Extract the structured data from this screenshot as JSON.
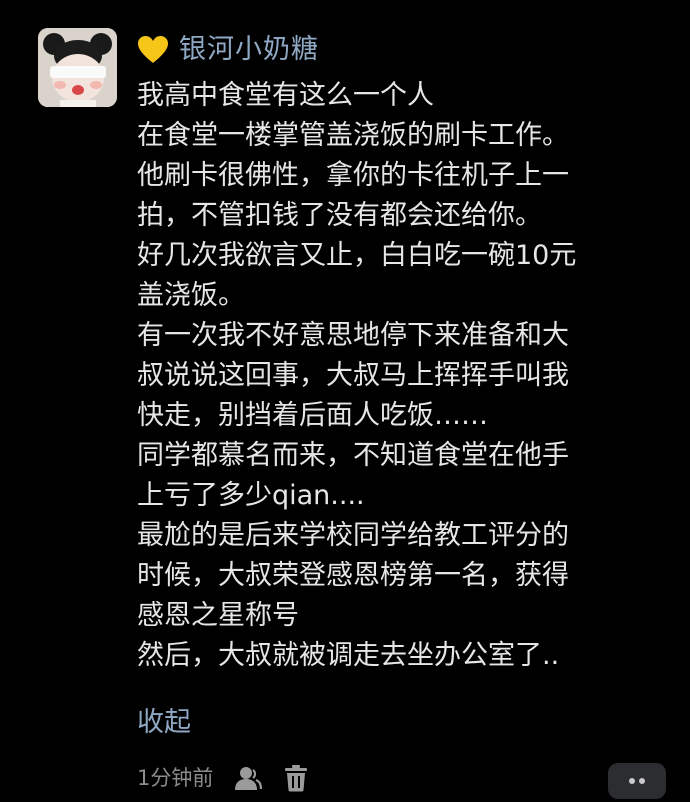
{
  "comment": {
    "username": "银河小奶糖",
    "badge_icon": "yellow-heart-icon",
    "avatar_icon": "user-avatar-photo",
    "lines": [
      "我高中食堂有这么一个人",
      "在食堂一楼掌管盖浇饭的刷卡工作。",
      "他刷卡很佛性，拿你的卡往机子上一",
      "拍，不管扣钱了没有都会还给你。",
      "好几次我欲言又止，白白吃一碗10元",
      "盖浇饭。",
      "有一次我不好意思地停下来准备和大",
      "叔说说这回事，大叔马上挥挥手叫我",
      "快走，别挡着后面人吃饭……",
      "同学都慕名而来，不知道食堂在他手",
      "上亏了多少qian....",
      "最尬的是后来学校同学给教工评分的",
      "时候，大叔荣登感恩榜第一名，获得",
      "感恩之星称号",
      "然后，大叔就被调走去坐办公室了.."
    ],
    "collapse_label": "收起",
    "timestamp": "1分钟前",
    "actions": {
      "user_icon": "user-icon",
      "delete_icon": "trash-icon",
      "more_icon": "more-dots-icon"
    }
  },
  "colors": {
    "background": "#000000",
    "text": "#e6e6e6",
    "link": "#8fa8c4",
    "muted": "#8c8c8c",
    "heart": "#f5c518",
    "more_button_bg": "#2b2d31"
  }
}
